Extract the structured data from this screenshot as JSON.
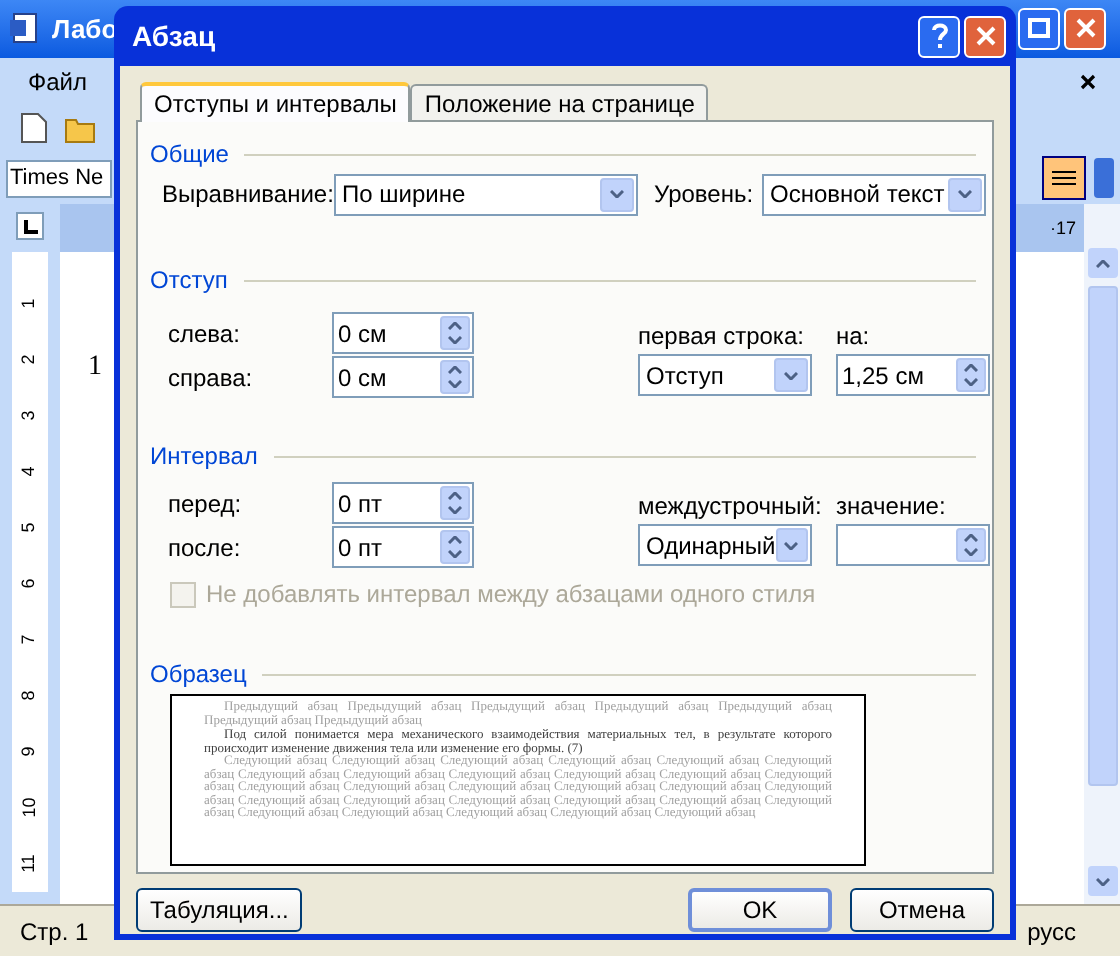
{
  "word_window": {
    "title": "Лабо",
    "menu": [
      "Файл"
    ],
    "font": "Times Ne",
    "ruler_end": "·17",
    "ruler_numbers": [
      "1",
      "2",
      "3",
      "4",
      "5",
      "6",
      "7",
      "8",
      "9",
      "10",
      "11"
    ],
    "doc_letters": [
      "1"
    ],
    "status": {
      "page": "Стр. 1",
      "language": "русс"
    }
  },
  "dialog": {
    "title": "Абзац",
    "tabs": [
      {
        "label": "Отступы и интервалы",
        "selected": true
      },
      {
        "label": "Положение на странице",
        "selected": false
      }
    ],
    "general": {
      "heading": "Общие",
      "alignment": {
        "label": "Выравнивание:",
        "value": "По ширине"
      },
      "level": {
        "label": "Уровень:",
        "value": "Основной текст"
      }
    },
    "indent": {
      "heading": "Отступ",
      "left": {
        "label": "слева:",
        "value": "0 см"
      },
      "right": {
        "label": "справа:",
        "value": "0 см"
      },
      "first_line": {
        "label": "первая строка:",
        "value": "Отступ"
      },
      "by": {
        "label": "на:",
        "value": "1,25 см"
      }
    },
    "spacing": {
      "heading": "Интервал",
      "before": {
        "label": "перед:",
        "value": "0 пт"
      },
      "after": {
        "label": "после:",
        "value": "0 пт"
      },
      "line_spacing": {
        "label": "междустрочный:",
        "value": "Одинарный"
      },
      "at": {
        "label": "значение:"
      },
      "no_space_same_style": {
        "label": "Не добавлять интервал между абзацами одного стиля",
        "checked": false,
        "disabled": true
      }
    },
    "preview": {
      "heading": "Образец",
      "previous": "Предыдущий абзац Предыдущий абзац Предыдущий абзац Предыдущий абзац Предыдущий абзац Предыдущий абзац Предыдущий абзац",
      "current": "Под силой понимается мера механического взаимодействия материальных тел, в результате которого происходит изменение движения тела или изменение его формы. (7)",
      "next": "Следующий абзац Следующий абзац Следующий абзац Следующий абзац Следующий абзац Следующий абзац Следующий абзац Следующий абзац Следующий абзац Следующий абзац Следующий абзац Следующий абзац Следующий абзац Следующий абзац Следующий абзац Следующий абзац Следующий абзац Следующий абзац Следующий абзац Следующий абзац Следующий абзац Следующий абзац Следующий абзац Следующий абзац Следующий абзац Следующий абзац Следующий абзац Следующий абзац Следующий абзац"
    },
    "buttons": [
      {
        "label": "Табуляция...",
        "default": false
      },
      {
        "label": "OK",
        "default": true
      },
      {
        "label": "Отмена",
        "default": false
      }
    ]
  }
}
